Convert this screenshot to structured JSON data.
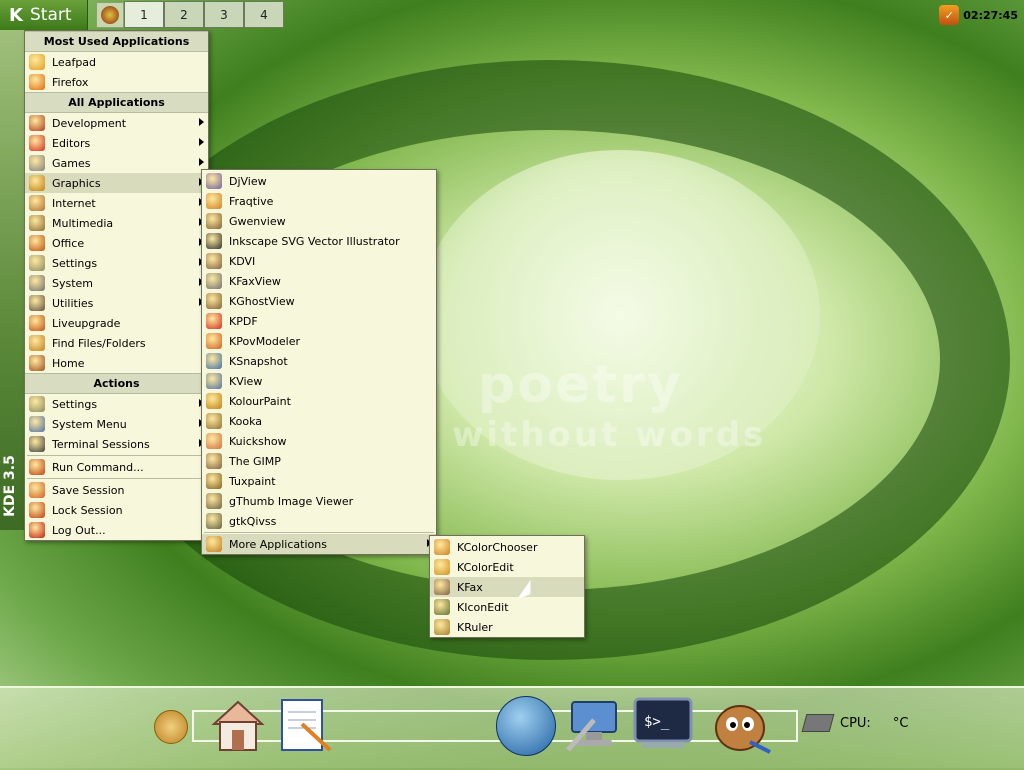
{
  "top_panel": {
    "start_label": "Start",
    "desktops": [
      "1",
      "2",
      "3",
      "4"
    ],
    "clock": "02:27:45"
  },
  "sidebar": {
    "version": "KDE 3.5"
  },
  "kmenu": {
    "most_used_header": "Most Used Applications",
    "most_used": [
      {
        "label": "Leafpad",
        "icon": "leafpad-icon",
        "color": "#e0a020"
      },
      {
        "label": "Firefox",
        "icon": "firefox-icon",
        "color": "#e06a10"
      }
    ],
    "all_apps_header": "All Applications",
    "categories": [
      {
        "label": "Development",
        "icon": "development-icon",
        "color": "#b04020"
      },
      {
        "label": "Editors",
        "icon": "editors-icon",
        "color": "#d03020"
      },
      {
        "label": "Games",
        "icon": "games-icon",
        "color": "#808080"
      },
      {
        "label": "Graphics",
        "icon": "graphics-icon",
        "color": "#c08010"
      },
      {
        "label": "Internet",
        "icon": "internet-icon",
        "color": "#b07030"
      },
      {
        "label": "Multimedia",
        "icon": "multimedia-icon",
        "color": "#8a6a30"
      },
      {
        "label": "Office",
        "icon": "office-icon",
        "color": "#c05010"
      },
      {
        "label": "Settings",
        "icon": "settings-icon",
        "color": "#8a8a60"
      },
      {
        "label": "System",
        "icon": "system-icon",
        "color": "#707070"
      },
      {
        "label": "Utilities",
        "icon": "utilities-icon",
        "color": "#605040"
      }
    ],
    "extras": [
      {
        "label": "Liveupgrade",
        "icon": "liveupgrade-icon",
        "color": "#c05010"
      },
      {
        "label": "Find Files/Folders",
        "icon": "find-icon",
        "color": "#c08020"
      },
      {
        "label": "Home",
        "icon": "home-icon",
        "color": "#a05020"
      }
    ],
    "actions_header": "Actions",
    "actions": [
      {
        "label": "Settings",
        "icon": "settings-icon",
        "color": "#8a8a60",
        "submenu": true
      },
      {
        "label": "System Menu",
        "icon": "system-menu-icon",
        "color": "#5070a0",
        "submenu": true
      },
      {
        "label": "Terminal Sessions",
        "icon": "terminal-icon",
        "color": "#404040",
        "submenu": true
      }
    ],
    "run": {
      "label": "Run Command...",
      "icon": "run-icon",
      "color": "#c04010"
    },
    "session": [
      {
        "label": "Save Session",
        "icon": "save-session-icon",
        "color": "#d06020"
      },
      {
        "label": "Lock Session",
        "icon": "lock-icon",
        "color": "#c04010"
      },
      {
        "label": "Log Out...",
        "icon": "logout-icon",
        "color": "#c02010"
      }
    ]
  },
  "graphics_menu": {
    "items": [
      {
        "label": "DjView",
        "icon": "djview-icon",
        "color": "#7060a0"
      },
      {
        "label": "Fraqtive",
        "icon": "fraqtive-icon",
        "color": "#d08020"
      },
      {
        "label": "Gwenview",
        "icon": "gwenview-icon",
        "color": "#806030"
      },
      {
        "label": "Inkscape SVG Vector Illustrator",
        "icon": "inkscape-icon",
        "color": "#303030"
      },
      {
        "label": "KDVI",
        "icon": "kdvi-icon",
        "color": "#806040"
      },
      {
        "label": "KFaxView",
        "icon": "kfaxview-icon",
        "color": "#707070"
      },
      {
        "label": "KGhostView",
        "icon": "kghostview-icon",
        "color": "#806030"
      },
      {
        "label": "KPDF",
        "icon": "kpdf-icon",
        "color": "#d03020"
      },
      {
        "label": "KPovModeler",
        "icon": "kpovmodeler-icon",
        "color": "#d06020"
      },
      {
        "label": "KSnapshot",
        "icon": "ksnapshot-icon",
        "color": "#4070a0"
      },
      {
        "label": "KView",
        "icon": "kview-icon",
        "color": "#5070a0"
      },
      {
        "label": "KolourPaint",
        "icon": "kolourpaint-icon",
        "color": "#c08010"
      },
      {
        "label": "Kooka",
        "icon": "kooka-icon",
        "color": "#907030"
      },
      {
        "label": "Kuickshow",
        "icon": "kuickshow-icon",
        "color": "#d07040"
      },
      {
        "label": "The GIMP",
        "icon": "gimp-icon",
        "color": "#806040"
      },
      {
        "label": "Tuxpaint",
        "icon": "tuxpaint-icon",
        "color": "#806020"
      },
      {
        "label": "gThumb Image Viewer",
        "icon": "gthumb-icon",
        "color": "#706040"
      },
      {
        "label": "gtkQivss",
        "icon": "gtkqivss-icon",
        "color": "#606040"
      }
    ],
    "more": {
      "label": "More Applications",
      "icon": "more-apps-icon",
      "color": "#c08020"
    }
  },
  "more_menu": {
    "items": [
      {
        "label": "KColorChooser",
        "icon": "kcolorchooser-icon",
        "color": "#d08020"
      },
      {
        "label": "KColorEdit",
        "icon": "kcoloredit-icon",
        "color": "#d09020"
      },
      {
        "label": "KFax",
        "icon": "kfax-icon",
        "color": "#806040"
      },
      {
        "label": "KIconEdit",
        "icon": "kiconedit-icon",
        "color": "#607030"
      },
      {
        "label": "KRuler",
        "icon": "kruler-icon",
        "color": "#a08030"
      }
    ]
  },
  "background": {
    "line1": "poetry",
    "line2": "without words"
  },
  "bottom_panel": {
    "cpu_label": "CPU:",
    "cpu_unit": "°C"
  }
}
